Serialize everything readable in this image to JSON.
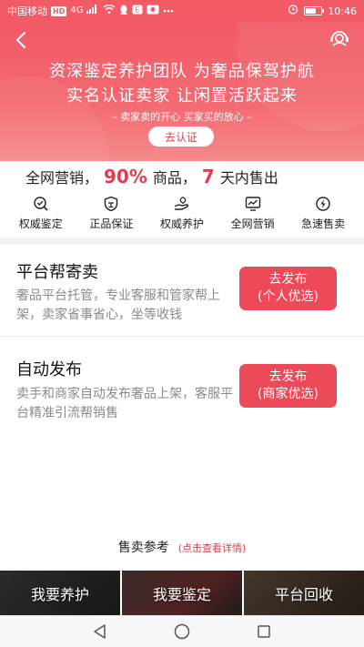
{
  "status_bar": {
    "carrier": "中国移动",
    "network_badge": "HD",
    "signal": "4G",
    "time": "10:46",
    "battery_level": 0.7
  },
  "hero": {
    "title": "资深鉴定养护团队 为奢品保驾护航",
    "subtitle": "实名认证卖家 让闲置活跃起来",
    "slogan": "– 卖家卖的开心 买家买的放心 –",
    "cta_label": "去认证",
    "back_icon": "chevron-left-icon",
    "service_icon": "customer-service-icon"
  },
  "stats": {
    "prefix": "全网营销，",
    "percent": "90%",
    "middle": "商品，",
    "days": "7",
    "suffix": "天内售出"
  },
  "features": [
    {
      "icon": "search-check-icon",
      "label": "权威鉴定"
    },
    {
      "icon": "authentic-shield-icon",
      "label": "正品保证"
    },
    {
      "icon": "hand-care-icon",
      "label": "权威养护"
    },
    {
      "icon": "chart-monitor-icon",
      "label": "全网营销"
    },
    {
      "icon": "lightning-icon",
      "label": "急速售卖"
    }
  ],
  "options": [
    {
      "title": "平台帮寄卖",
      "description": "奢品平台托管，专业客服和管家帮上架，卖家省事省心，坐等收钱",
      "button_line1": "去发布",
      "button_line2": "(个人优选)"
    },
    {
      "title": "自动发布",
      "description": "卖手和商家自动发布奢品上架，客服平台精准引流帮销售",
      "button_line1": "去发布",
      "button_line2": "(商家优选)"
    }
  ],
  "reference": {
    "title": "售卖参考",
    "hint": "(点击查看详情)"
  },
  "tiles": [
    {
      "label": "我要养护"
    },
    {
      "label": "我要鉴定"
    },
    {
      "label": "平台回收"
    }
  ],
  "colors": {
    "brand_red": "#f25a66",
    "button_red": "#ec4a58",
    "accent_text_red": "#e53c4d"
  }
}
